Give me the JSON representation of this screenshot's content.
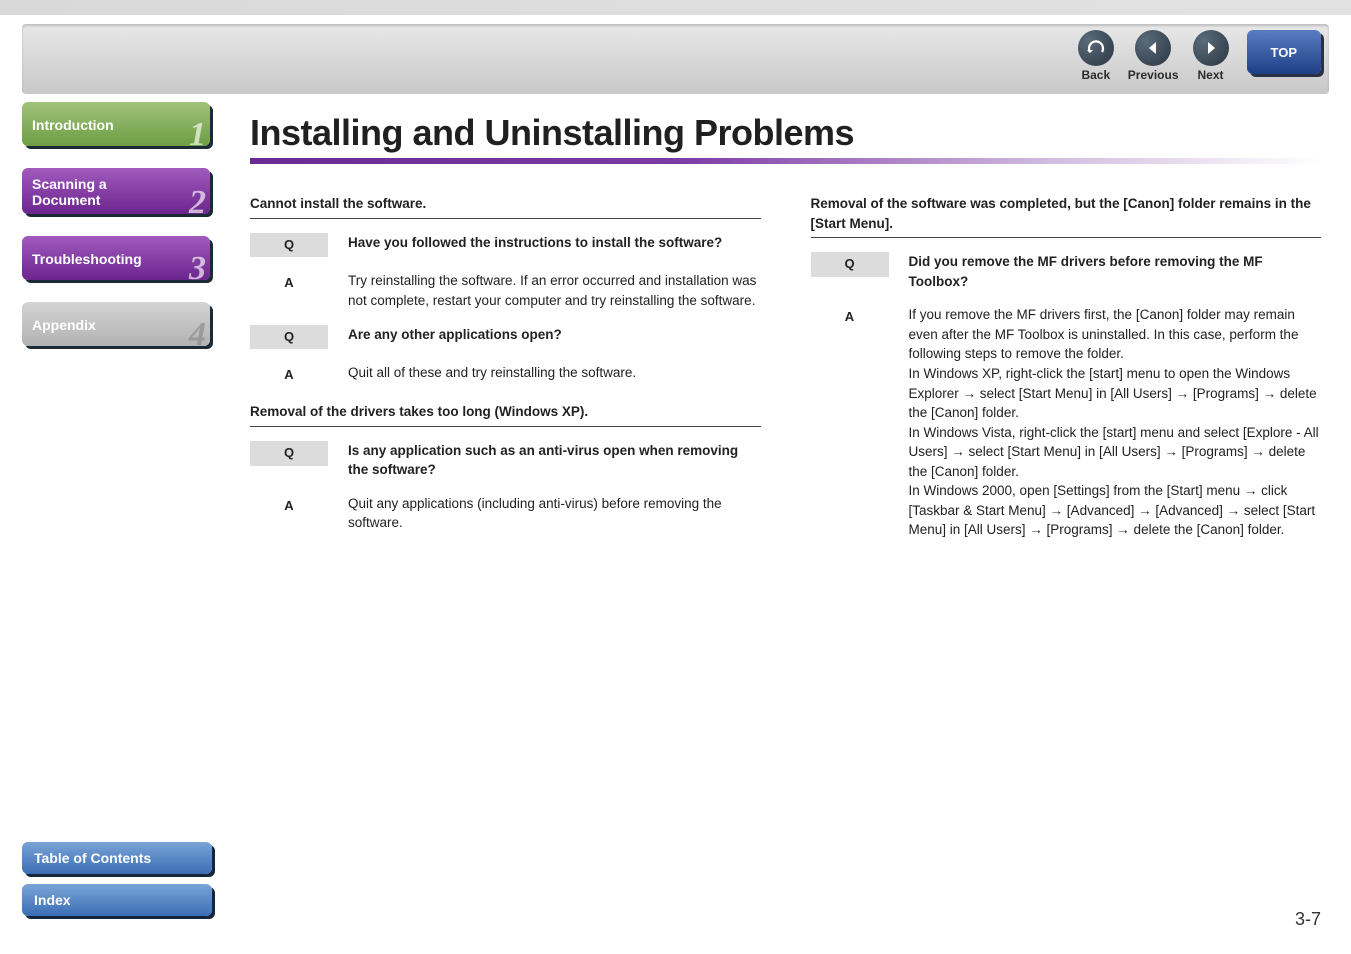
{
  "toolbar": {
    "back": "Back",
    "previous": "Previous",
    "next": "Next",
    "top": "TOP"
  },
  "sidebar": {
    "items": [
      {
        "label": "Introduction",
        "num": "1"
      },
      {
        "label1": "Scanning a",
        "label2": "Document",
        "num": "2"
      },
      {
        "label": "Troubleshooting",
        "num": "3"
      },
      {
        "label": "Appendix",
        "num": "4"
      }
    ]
  },
  "bottomTabs": {
    "toc": "Table of Contents",
    "index": "Index"
  },
  "page": {
    "title": "Installing and Uninstalling Problems",
    "pagenum": "3-7"
  },
  "left": {
    "s1": "Cannot install the software.",
    "q1": "Have you followed the instructions to install the software?",
    "a1": "Try reinstalling the software. If an error occurred and installation was not complete, restart your computer and try reinstalling the software.",
    "q2": "Are any other applications open?",
    "a2": "Quit all of these and try reinstalling the software.",
    "s2": "Removal of the drivers takes too long (Windows XP).",
    "q3": "Is any application such as an anti-virus open when removing the software?",
    "a3": "Quit any applications (including anti-virus) before removing the software."
  },
  "right": {
    "s1": "Removal of the software was completed, but the [Canon] folder remains in the [Start Menu].",
    "q1": "Did you remove the MF drivers before removing the MF Toolbox?",
    "a1": "If you remove the MF drivers first, the [Canon] folder may remain even after the MF Toolbox is uninstalled. In this case, perform the following steps to remove the folder.\nIn Windows XP, right-click the [start] menu to open the Windows Explorer → select [Start Menu] in [All Users] → [Programs] → delete the [Canon] folder.\nIn Windows Vista, right-click the [start] menu and select [Explore - All Users] → select [Start Menu] in [All Users] → [Programs] → delete the [Canon] folder.\nIn Windows 2000, open [Settings] from the [Start] menu → click [Taskbar & Start Menu] → [Advanced] → [Advanced] → select [Start Menu] in [All Users] → [Programs] → delete the [Canon] folder."
  },
  "labels": {
    "q": "Q",
    "a": "A"
  }
}
